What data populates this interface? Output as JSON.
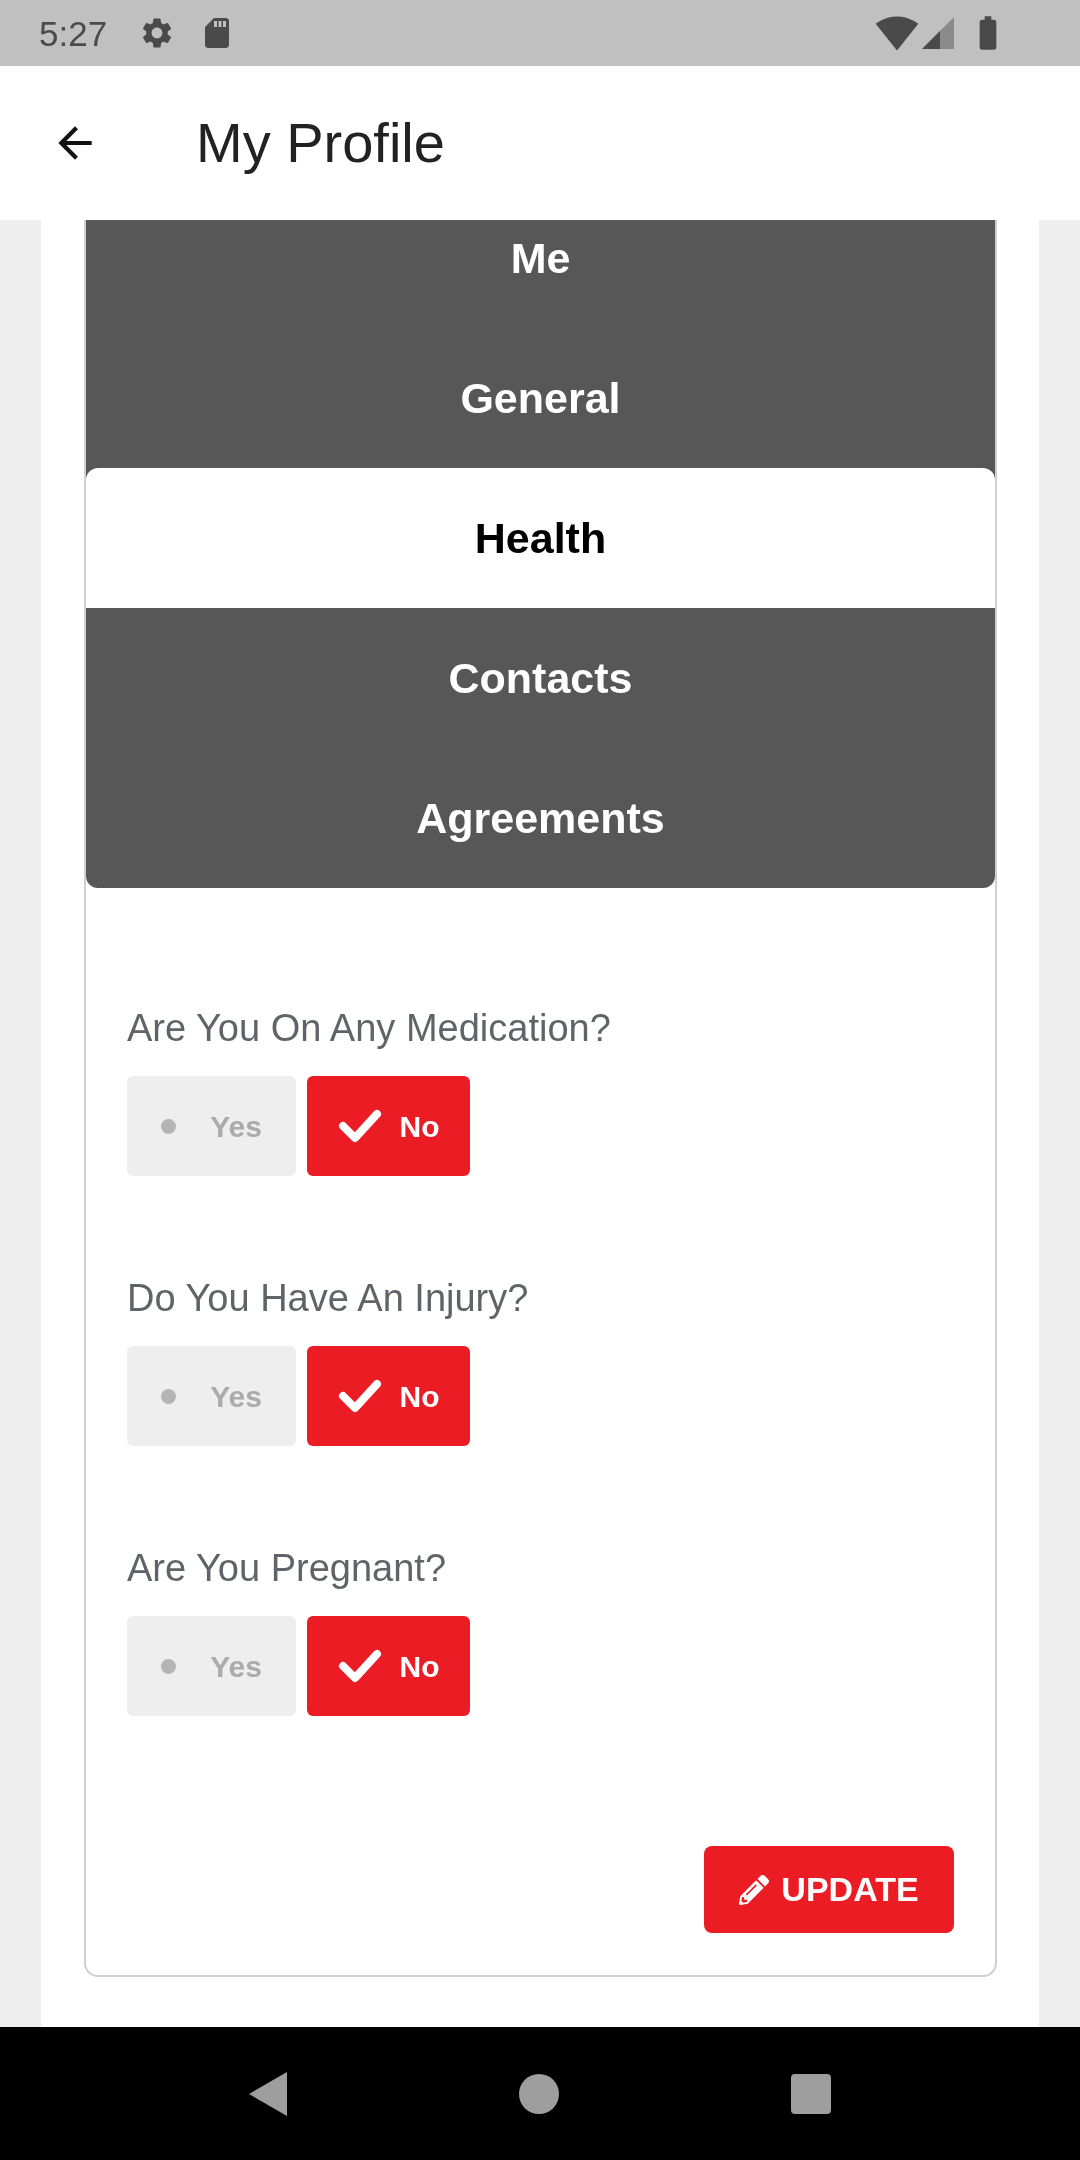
{
  "status_bar": {
    "time": "5:27"
  },
  "app_bar": {
    "title": "My Profile"
  },
  "tabs": [
    {
      "label": "Me",
      "selected": false
    },
    {
      "label": "General",
      "selected": false
    },
    {
      "label": "Health",
      "selected": true
    },
    {
      "label": "Contacts",
      "selected": false
    },
    {
      "label": "Agreements",
      "selected": false
    }
  ],
  "questions": [
    {
      "label": "Are You On Any Medication?",
      "options": [
        {
          "label": "Yes",
          "selected": false
        },
        {
          "label": "No",
          "selected": true
        }
      ]
    },
    {
      "label": "Do You Have An Injury?",
      "options": [
        {
          "label": "Yes",
          "selected": false
        },
        {
          "label": "No",
          "selected": true
        }
      ]
    },
    {
      "label": "Are You Pregnant?",
      "options": [
        {
          "label": "Yes",
          "selected": false
        },
        {
          "label": "No",
          "selected": true
        }
      ]
    }
  ],
  "update_button": {
    "label": "UPDATE"
  }
}
